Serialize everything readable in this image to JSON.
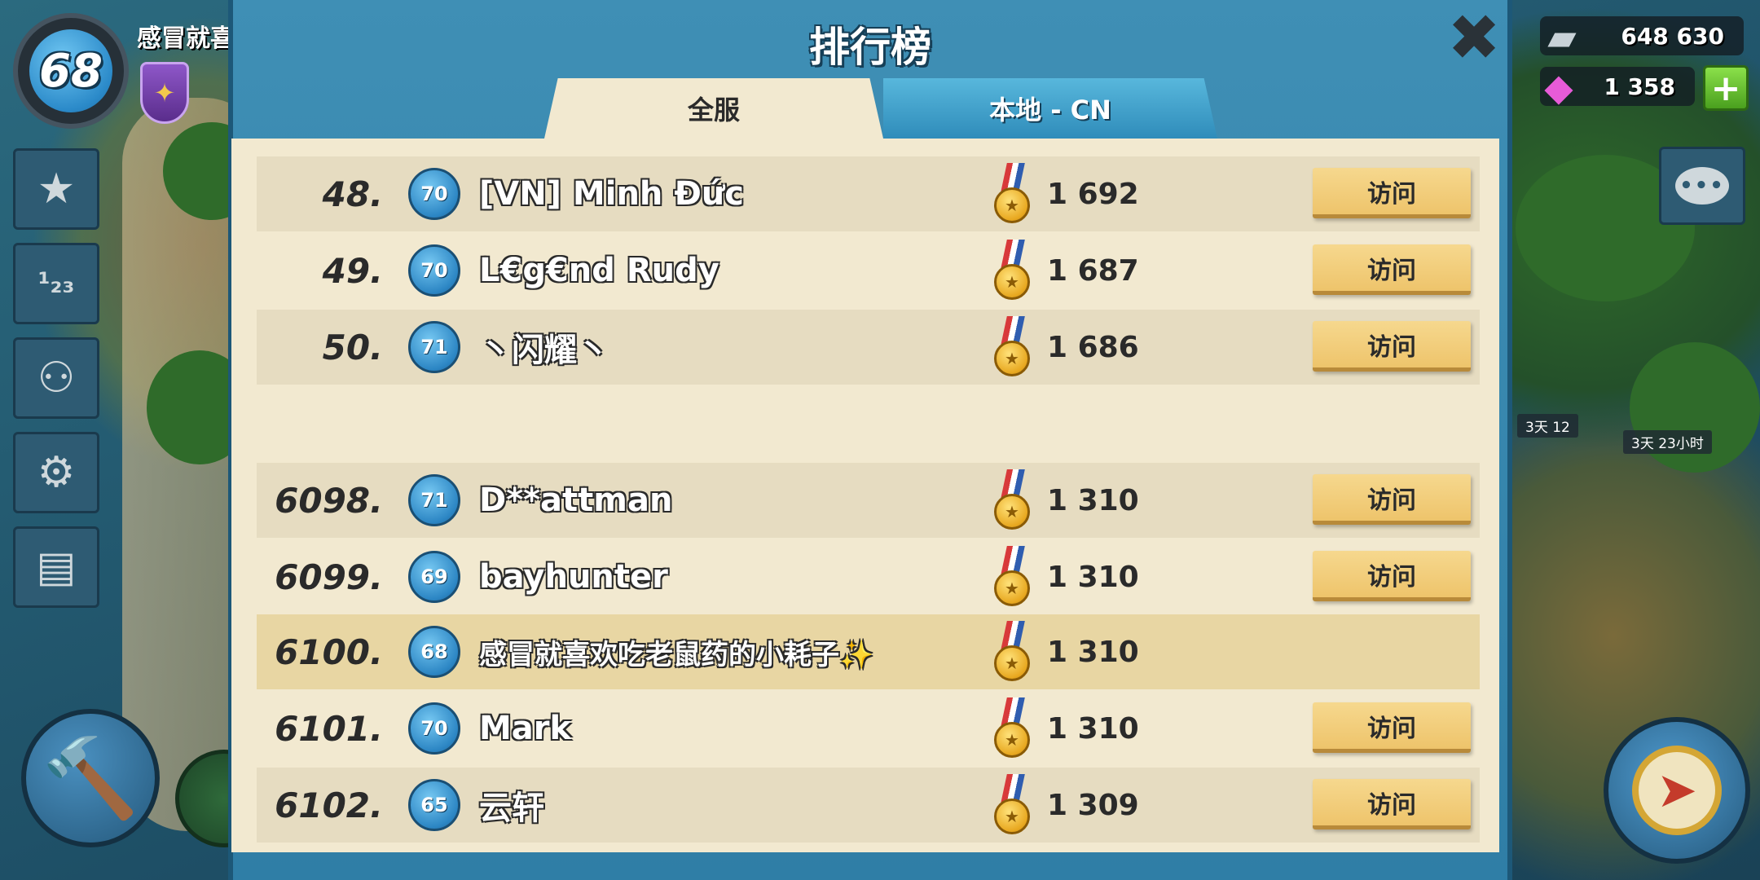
{
  "player": {
    "level": "68",
    "name": "感冒就喜"
  },
  "resources": {
    "iron": "648 630",
    "gems": "1 358"
  },
  "timers": {
    "first": "3天 12",
    "second": "3天 23小时"
  },
  "dialog": {
    "title": "排行榜",
    "tabs": [
      {
        "label": "全服"
      },
      {
        "label": "本地 - CN"
      }
    ],
    "visit_label": "访问",
    "rows": [
      {
        "rank": "48.",
        "level": "70",
        "name": "[VN] Minh Đức",
        "score": "1 692"
      },
      {
        "rank": "49.",
        "level": "70",
        "name": "L€g€nd Rudy",
        "score": "1 687"
      },
      {
        "rank": "50.",
        "level": "71",
        "name": "丶闪耀丶",
        "score": "1 686"
      },
      {
        "rank": "6098.",
        "level": "71",
        "name": "D**attman",
        "score": "1 310"
      },
      {
        "rank": "6099.",
        "level": "69",
        "name": "bayhunter",
        "score": "1 310"
      },
      {
        "rank": "6100.",
        "level": "68",
        "name": "感冒就喜欢吃老鼠药的小耗子✨",
        "score": "1 310"
      },
      {
        "rank": "6101.",
        "level": "70",
        "name": "Mark",
        "score": "1 310"
      },
      {
        "rank": "6102.",
        "level": "65",
        "name": "云轩",
        "score": "1 309"
      }
    ]
  },
  "icons": {
    "close": "close-icon",
    "medal": "medal-icon",
    "chat": "chat-icon",
    "compass": "compass-icon",
    "hammer": "hammer-icon"
  }
}
